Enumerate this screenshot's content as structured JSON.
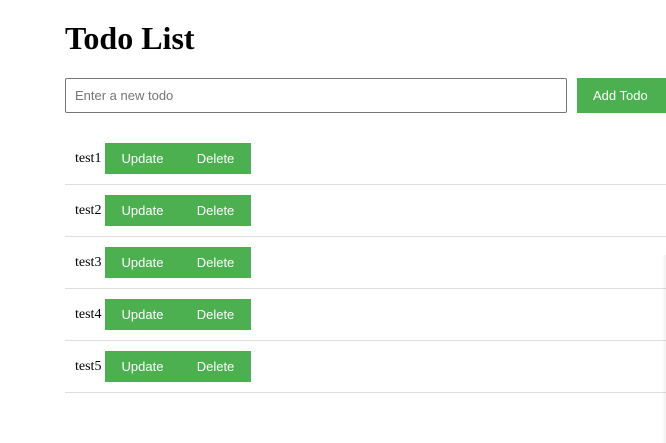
{
  "page": {
    "title": "Todo List"
  },
  "add_form": {
    "placeholder": "Enter a new todo",
    "value": "",
    "button_label": "Add Todo"
  },
  "todos": [
    {
      "text": "test1",
      "update_label": "Update",
      "delete_label": "Delete"
    },
    {
      "text": "test2",
      "update_label": "Update",
      "delete_label": "Delete"
    },
    {
      "text": "test3",
      "update_label": "Update",
      "delete_label": "Delete"
    },
    {
      "text": "test4",
      "update_label": "Update",
      "delete_label": "Delete"
    },
    {
      "text": "test5",
      "update_label": "Update",
      "delete_label": "Delete"
    }
  ],
  "colors": {
    "accent": "#4caf50",
    "button_text": "#ffffff",
    "divider": "#dddddd"
  }
}
